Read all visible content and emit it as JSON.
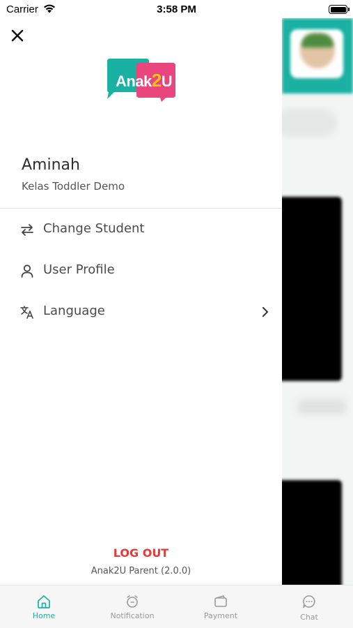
{
  "status_bar": {
    "carrier": "Carrier",
    "time": "3:58 PM"
  },
  "logo": {
    "text_prefix": "Anak",
    "text_highlight": "2",
    "text_suffix": "U",
    "colors": {
      "teal": "#1ab1a3",
      "pink": "#e8467c",
      "yellow": "#f6c21a"
    }
  },
  "user": {
    "name": "Aminah",
    "class_name": "Kelas Toddler Demo"
  },
  "menu": {
    "items": [
      {
        "label": "Change Student",
        "icon": "swap-arrows-icon"
      },
      {
        "label": "User Profile",
        "icon": "user-icon"
      },
      {
        "label": "Language",
        "icon": "translate-icon",
        "has_chevron": true
      }
    ]
  },
  "footer": {
    "logout_label": "LOG OUT",
    "version": "Anak2U Parent (2.0.0)"
  },
  "tab_bar": {
    "tabs": [
      {
        "label": "Home",
        "icon": "home-icon",
        "active": true
      },
      {
        "label": "Notification",
        "icon": "bell-icon",
        "active": false
      },
      {
        "label": "Payment",
        "icon": "wallet-icon",
        "active": false
      },
      {
        "label": "Chat",
        "icon": "chat-icon",
        "active": false
      }
    ]
  },
  "colors": {
    "accent": "#1ab1a3",
    "logout": "#e53935",
    "inactive_tab": "#9a9a9a"
  }
}
